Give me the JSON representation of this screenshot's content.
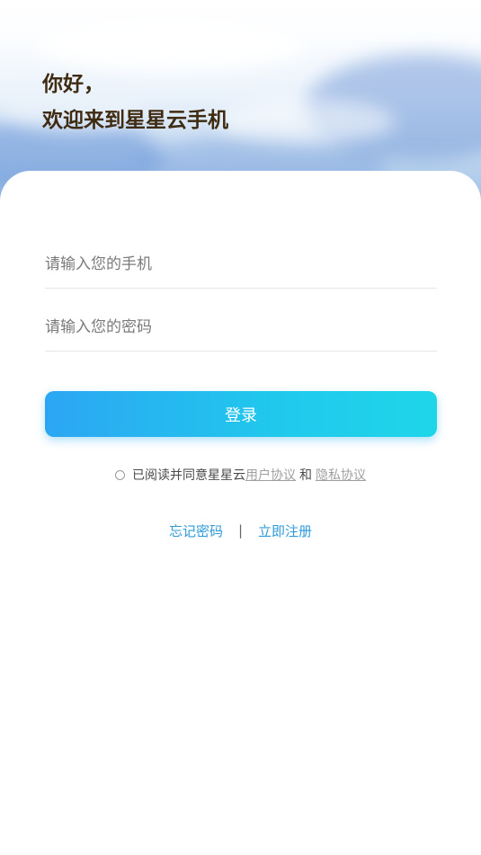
{
  "header": {
    "greeting_line1": "你好，",
    "greeting_line2": "欢迎来到星星云手机"
  },
  "form": {
    "phone_placeholder": "请输入您的手机",
    "phone_value": "",
    "password_placeholder": "请输入您的密码",
    "password_value": "",
    "login_label": "登录"
  },
  "agreement": {
    "checked": false,
    "prefix": "已阅读并同意星星云",
    "user_agreement": "用户协议",
    "and": "和",
    "privacy_policy": "隐私协议"
  },
  "links": {
    "forgot_password": "忘记密码",
    "separator": "|",
    "register": "立即注册"
  },
  "colors": {
    "accent_start": "#2ca6f3",
    "accent_end": "#1fd6e9",
    "link": "#2f9ad8",
    "heading": "#3f2b12"
  }
}
